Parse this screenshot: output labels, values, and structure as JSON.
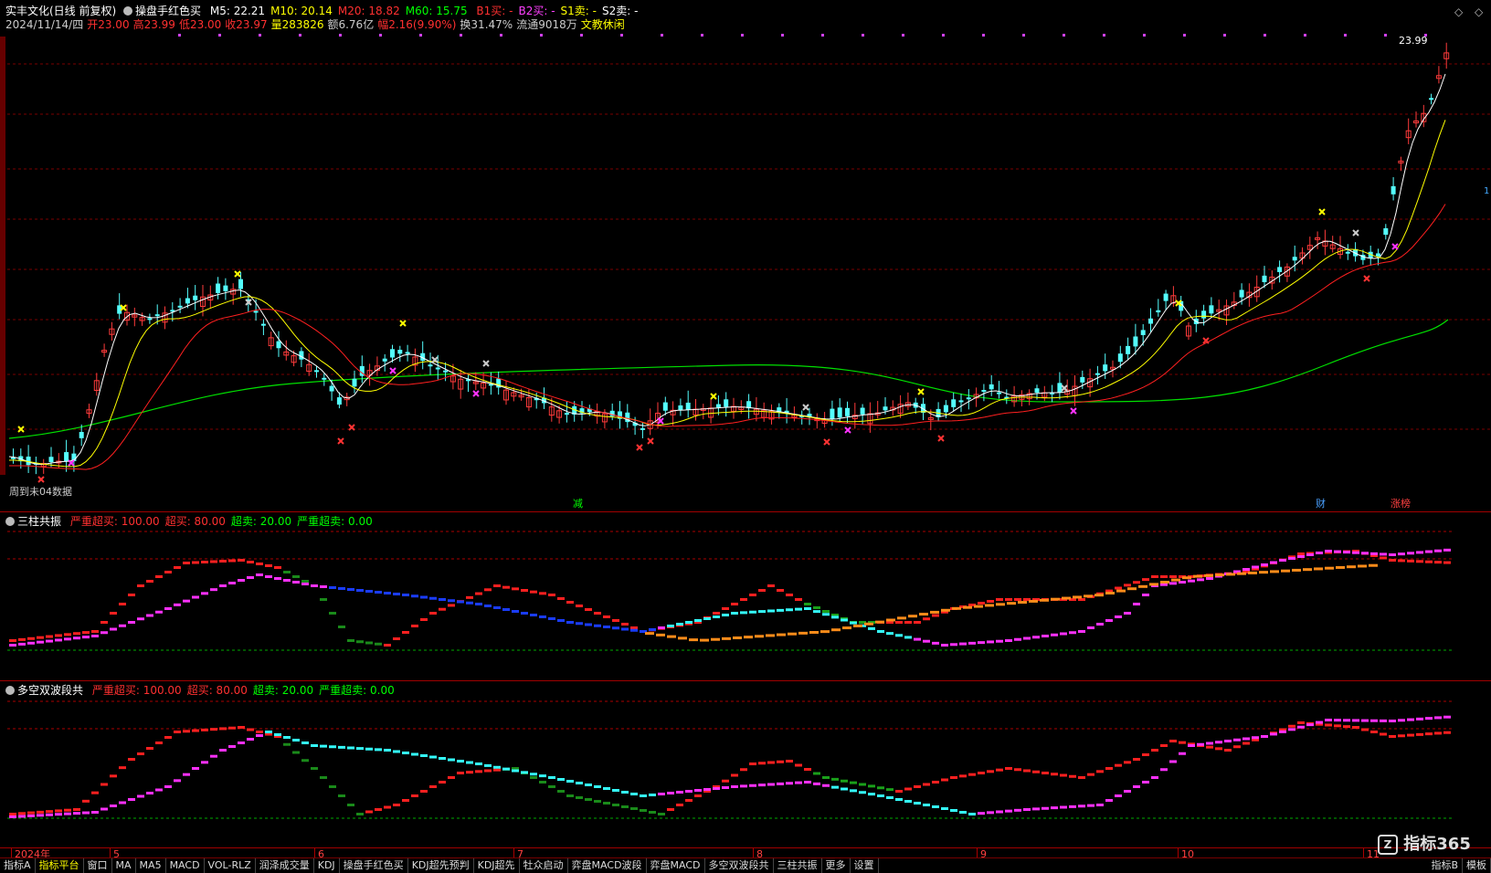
{
  "header": {
    "stock": "实丰文化(日线 前复权)",
    "indicator": "操盘手红色买",
    "ma": [
      {
        "label": "M5: 22.21",
        "color": "#ffffff"
      },
      {
        "label": "M10: 20.14",
        "color": "#ffff00"
      },
      {
        "label": "M20: 18.82",
        "color": "#ff3030"
      },
      {
        "label": "M60: 15.75",
        "color": "#00ff00"
      }
    ],
    "signals": [
      {
        "label": "B1买: -",
        "color": "#ff3030"
      },
      {
        "label": "B2买: -",
        "color": "#ff40ff"
      },
      {
        "label": "S1卖: -",
        "color": "#ffff00"
      },
      {
        "label": "S2卖: -",
        "color": "#ffffff"
      }
    ],
    "line2": [
      {
        "label": "2024/11/14/四",
        "color": "#cccccc"
      },
      {
        "label": "开23.00",
        "color": "#ff3030"
      },
      {
        "label": "高23.99",
        "color": "#ff3030"
      },
      {
        "label": "低23.00",
        "color": "#ff3030"
      },
      {
        "label": "收23.97",
        "color": "#ff3030"
      },
      {
        "label": "量283826",
        "color": "#ffff00"
      },
      {
        "label": "额6.76亿",
        "color": "#cccccc"
      },
      {
        "label": "幅2.16(9.90%)",
        "color": "#ff3030"
      },
      {
        "label": "换31.47%",
        "color": "#cccccc"
      },
      {
        "label": "流通9018万",
        "color": "#cccccc"
      },
      {
        "label": "文教休闲",
        "color": "#ffff00"
      }
    ]
  },
  "chart_labels": {
    "price_high": "23.99",
    "no_data": "周到未04数据",
    "events": [
      {
        "label": "减",
        "color": "#00ff00"
      },
      {
        "label": "财",
        "color": "#4aa0ff"
      },
      {
        "label": "涨榜",
        "color": "#ff4040"
      }
    ],
    "right_marker": "1"
  },
  "panels": [
    {
      "title": "三柱共振",
      "params": [
        {
          "label": "严重超买: 100.00",
          "color": "#ff3030"
        },
        {
          "label": "超买: 80.00",
          "color": "#ff3030"
        },
        {
          "label": "超卖: 20.00",
          "color": "#00ff00"
        },
        {
          "label": "严重超卖: 0.00",
          "color": "#00ff00"
        }
      ]
    },
    {
      "title": "多空双波段共",
      "params": [
        {
          "label": "严重超买: 100.00",
          "color": "#ff3030"
        },
        {
          "label": "超买: 80.00",
          "color": "#ff3030"
        },
        {
          "label": "超卖: 20.00",
          "color": "#00ff00"
        },
        {
          "label": "严重超卖: 0.00",
          "color": "#00ff00"
        }
      ]
    }
  ],
  "time_axis": [
    "2024年",
    "5",
    "6",
    "7",
    "8",
    "9",
    "10",
    "11"
  ],
  "tabs": [
    "指标A",
    "指标平台",
    "窗口",
    "MA",
    "MA5",
    "MACD",
    "VOL-RLZ",
    "润泽成交量",
    "KDJ",
    "操盘手红色买",
    "KDJ超先预判",
    "KDJ超先",
    "牡众启动",
    "弈盘MACD波段",
    "弈盘MACD",
    "多空双波段共",
    "三柱共振",
    "更多",
    "设置"
  ],
  "active_tab": "指标平台",
  "right_tabs": [
    "指标B",
    "模板"
  ],
  "watermark": "指标365"
}
